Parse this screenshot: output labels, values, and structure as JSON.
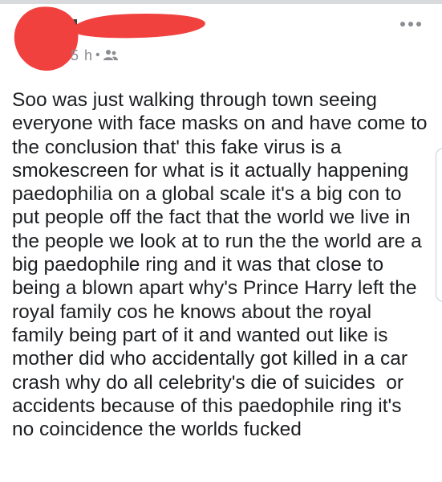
{
  "post": {
    "meta": {
      "time": "5 h",
      "separator": "•",
      "audience_icon": "friends-icon"
    },
    "body": "Soo was just walking through town seeing\neveryone with face masks on and have come to\nthe conclusion that' this fake virus is a\nsmokescreen for what is it actually happening\npaedophilia on a global scale it's a big con to\nput people off the fact that the world we live in\nthe people we look at to run the the world are a\nbig paedophile ring and it was that close to\nbeing a blown apart why's Prince Harry left the\nroyal family cos he knows about the royal\nfamily being part of it and wanted out like is\nmother did who accidentally got killed in a car\ncrash why do all celebrity's die of suicides  or\naccidents because of this paedophile ring it's\nno coincidence the worlds fucked"
  },
  "colors": {
    "redaction": "#f0413f",
    "meta_text": "#8a8d91",
    "body_text": "#1c1e21"
  }
}
